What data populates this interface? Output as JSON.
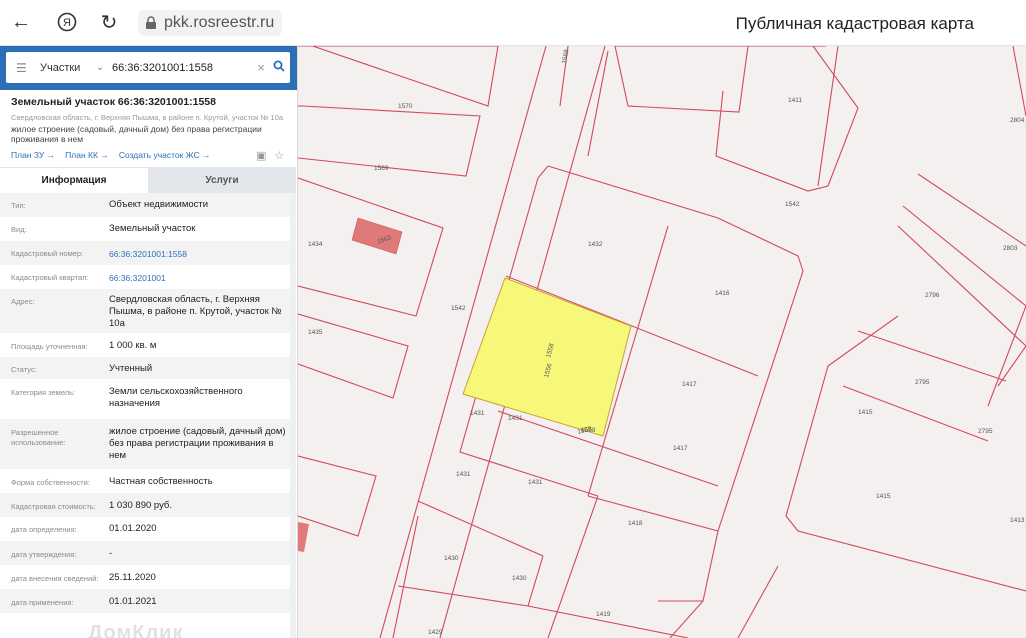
{
  "browser": {
    "url": "pkk.rosreestr.ru",
    "page_title": "Публичная кадастровая карта"
  },
  "search": {
    "mode": "Участки",
    "query": "66:36:3201001:1558"
  },
  "object": {
    "title": "Земельный участок 66:36:3201001:1558",
    "address": "Свердловская область, г. Верхняя Пышма, в районе п. Крутой, участок № 10а",
    "description": "жилое строение (садовый, дачный дом) без права регистрации проживания в нем",
    "links": [
      "План ЗУ",
      "План КК",
      "Создать участок ЖС"
    ]
  },
  "tabs": [
    "Информация",
    "Услуги"
  ],
  "info": [
    {
      "label": "Тип:",
      "value": "Объект недвижимости"
    },
    {
      "label": "Вид:",
      "value": "Земельный участок"
    },
    {
      "label": "Кадастровый номер:",
      "value": "66:36:3201001:1558"
    },
    {
      "label": "Кадастровый квартал:",
      "value": "66:36:3201001"
    },
    {
      "label": "Адрес:",
      "value": "Свердловская область, г. Верхняя Пышма, в районе п. Крутой, участок № 10а"
    },
    {
      "label": "Площадь уточненная:",
      "value": "1 000 кв. м"
    },
    {
      "label": "Статус:",
      "value": "Учтенный"
    },
    {
      "label": "Категория земель:",
      "value": "Земли сельскохозяйственного назначения"
    },
    {
      "label": "Разрешенное использование:",
      "value": "жилое строение (садовый, дачный дом) без права регистрации проживания в нем"
    },
    {
      "label": "Форма собственности:",
      "value": "Частная собственность"
    },
    {
      "label": "Кадастровая стоимость:",
      "value": "1 030 890 руб."
    },
    {
      "label": "дата определения:",
      "value": "01.01.2020"
    },
    {
      "label": "дата утверждения:",
      "value": "-"
    },
    {
      "label": "дата внесения сведений:",
      "value": "25.11.2020"
    },
    {
      "label": "дата применения:",
      "value": "01.01.2021"
    }
  ],
  "map": {
    "parcel_labels": [
      "1568",
      "1570",
      "1411",
      "2804",
      "1569",
      "1434",
      "1563",
      "1432",
      "1542",
      "2803",
      "1416",
      "2796",
      "1542",
      "1435",
      "1558",
      "1417",
      "2795",
      "1415",
      "2795",
      "1431",
      "1431",
      "1558",
      "1417",
      "1431",
      "1431",
      "1415",
      "1418",
      "1413",
      "1430",
      "1430",
      "1419",
      "1429",
      "1556",
      "1558"
    ],
    "highlight_color": "#f7f77a",
    "building_color": "#e07a7a",
    "line_color": "#d1495b"
  },
  "watermark": "ДомКлик"
}
